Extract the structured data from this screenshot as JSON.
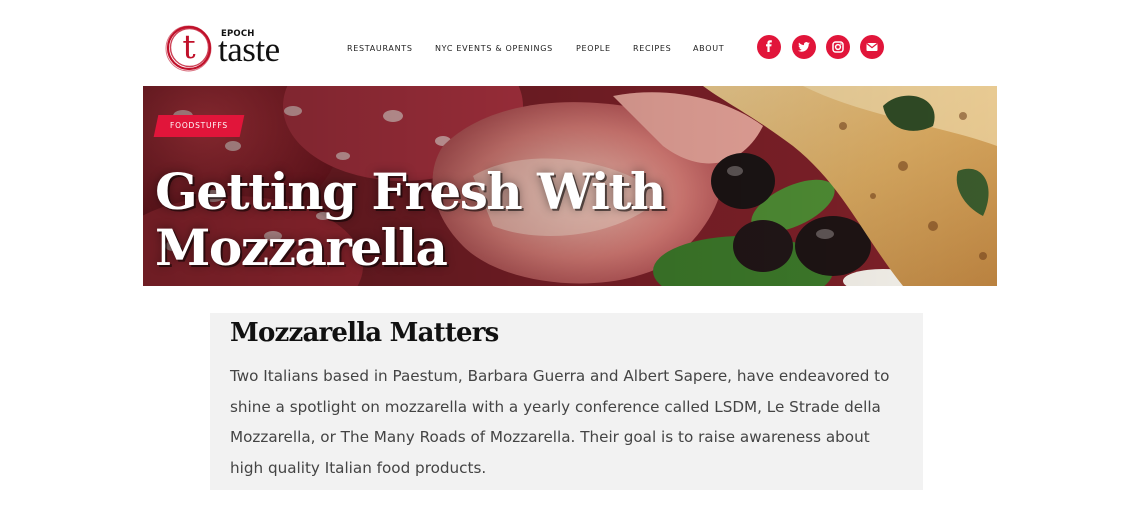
{
  "brand": {
    "mark": "t",
    "small_text": "EPOCH",
    "word": "taste",
    "color": "#c0102a"
  },
  "nav": {
    "items": [
      {
        "label": "RESTAURANTS"
      },
      {
        "label": "NYC EVENTS & OPENINGS"
      },
      {
        "label": "PEOPLE"
      },
      {
        "label": "RECIPES"
      },
      {
        "label": "ABOUT"
      }
    ]
  },
  "social": [
    {
      "icon": "facebook-icon"
    },
    {
      "icon": "twitter-icon"
    },
    {
      "icon": "instagram-icon"
    },
    {
      "icon": "email-icon"
    }
  ],
  "accent_color": "#e1153a",
  "hero": {
    "category": "FOODSTUFFS",
    "title": "Getting Fresh With Mozzarella"
  },
  "article": {
    "heading": "Mozzarella Matters",
    "body": "Two Italians based in Paestum, Barbara Guerra and Albert Sapere, have endeavored to shine a spotlight on mozzarella with a yearly conference called LSDM, Le Strade della Mozzarella, or The Many Roads of Mozzarella. Their goal is to raise awareness about high quality Italian food products."
  }
}
